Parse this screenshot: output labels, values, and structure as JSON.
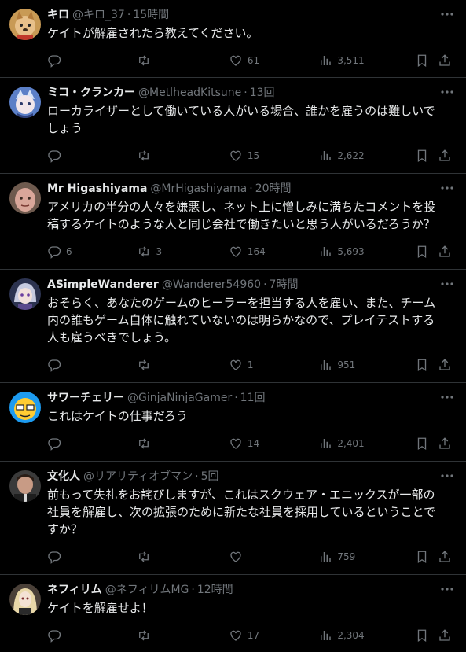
{
  "tweets": [
    {
      "name": "キロ",
      "handle": "@キロ_37",
      "time": "15時間",
      "text": "ケイトが解雇されたら教えてください。",
      "replies": "",
      "retweets": "",
      "likes": "61",
      "views": "3,511"
    },
    {
      "name": "ミコ・クランカー",
      "handle": "@MetlheadKitsune",
      "time": "13回",
      "text": "ローカライザーとして働いている人がいる場合、誰かを雇うのは難しいでしょう",
      "replies": "",
      "retweets": "",
      "likes": "15",
      "views": "2,622"
    },
    {
      "name": "Mr Higashiyama",
      "handle": "@MrHigashiyama",
      "time": "20時間",
      "text": "アメリカの半分の人々を嫌悪し、ネット上に憎しみに満ちたコメントを投稿するケイトのような人と同じ会社で働きたいと思う人がいるだろうか？",
      "replies": "6",
      "retweets": "3",
      "likes": "164",
      "views": "5,693"
    },
    {
      "name": "ASimpleWanderer",
      "handle": "@Wanderer54960",
      "time": "7時間",
      "text": "おそらく、あなたのゲームのヒーラーを担当する人を雇い、また、チーム内の誰もゲーム自体に触れていないのは明らかなので、プレイテストする人も雇うべきでしょう。",
      "replies": "",
      "retweets": "",
      "likes": "1",
      "views": "951"
    },
    {
      "name": "サワーチェリー",
      "handle": "@GinjaNinjaGamer",
      "time": "11回",
      "text": "これはケイトの仕事だろう",
      "replies": "",
      "retweets": "",
      "likes": "14",
      "views": "2,401"
    },
    {
      "name": "文化人",
      "handle": "@リアリティオブマン",
      "time": "5回",
      "text": "前もって失礼をお詫びしますが、これはスクウェア・エニックスが一部の社員を解雇し、次の拡張のために新たな社員を採用しているということですか？",
      "replies": "",
      "retweets": "",
      "likes": "",
      "views": "759"
    },
    {
      "name": "ネフィリム",
      "handle": "@ネフィリムMG",
      "time": "12時間",
      "text": "ケイトを解雇せよ！",
      "replies": "",
      "retweets": "",
      "likes": "17",
      "views": "2,304"
    }
  ],
  "ui": {
    "separator": "·",
    "icons": {
      "more": "more-icon",
      "reply": "reply-icon",
      "retweet": "retweet-icon",
      "like": "like-icon",
      "views": "views-icon",
      "bookmark": "bookmark-icon",
      "share": "share-icon"
    },
    "colors": {
      "background": "#000000",
      "text": "#e7e9ea",
      "muted": "#71767b",
      "divider": "#2f3336"
    }
  }
}
